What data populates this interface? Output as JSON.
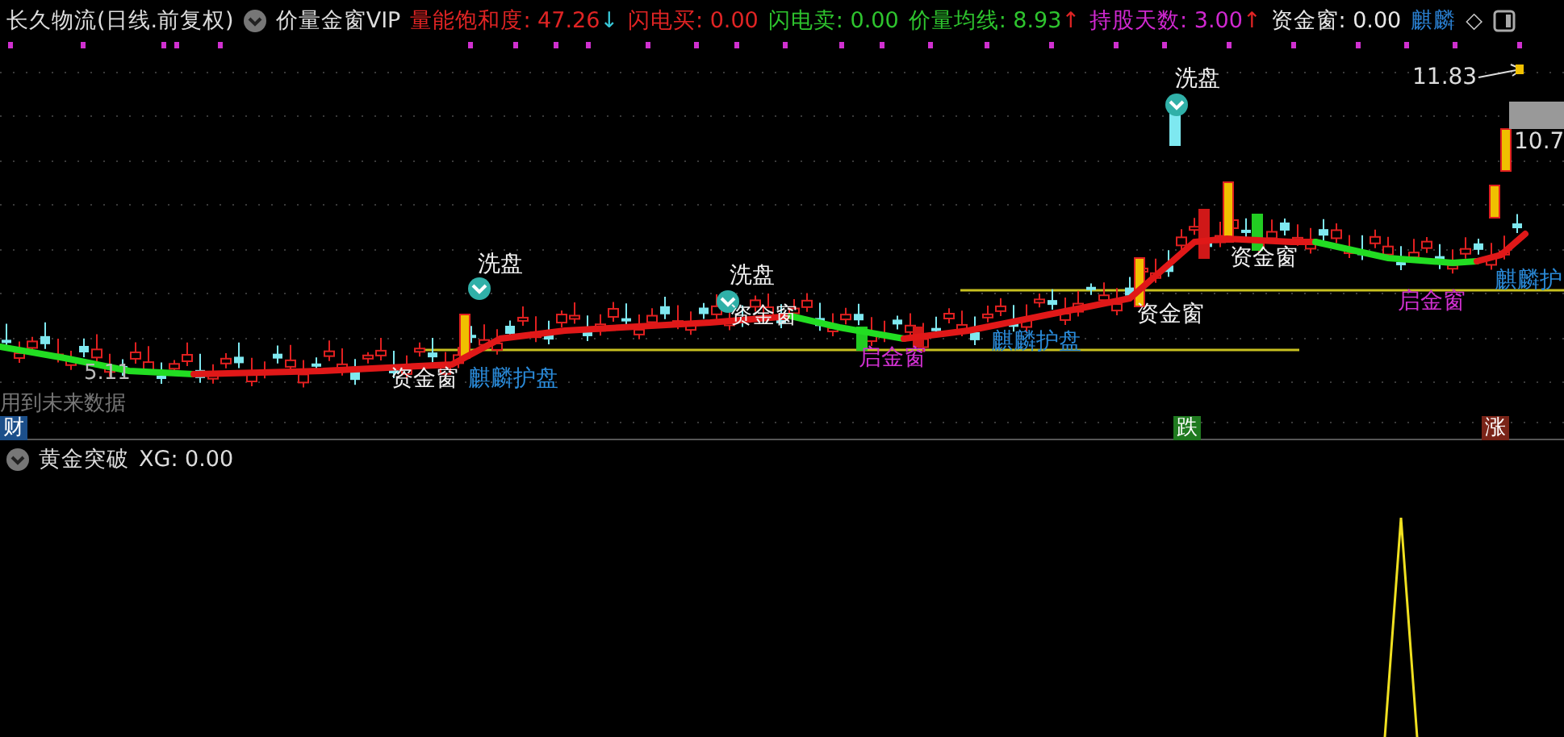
{
  "header": {
    "stock": "长久物流(日线.前复权)",
    "indicator": "价量金窗VIP"
  },
  "readouts": [
    {
      "text": "量能饱和度: 47.26",
      "color": "#e02424",
      "arrow": {
        "text": "↓",
        "kind": "down"
      }
    },
    {
      "text": "闪电买: 0.00",
      "color": "#e02424"
    },
    {
      "text": "闪电卖: 0.00",
      "color": "#2ec42e"
    },
    {
      "text": "价量均线: 8.93",
      "color": "#2ec42e",
      "arrow": {
        "text": "↑",
        "kind": "up"
      }
    },
    {
      "text": "持股天数: 3.00",
      "color": "#d028d0",
      "arrow": {
        "text": "↑",
        "kind": "up"
      }
    },
    {
      "text": "资金窗: 0.00",
      "color": "#e8e8e8"
    },
    {
      "text": "麒麟",
      "color": "#2a7fd0"
    }
  ],
  "header_mark": "◇",
  "annotations": [
    {
      "kind": "wash",
      "text": "洗盘"
    },
    {
      "kind": "wash",
      "text": "洗盘"
    },
    {
      "kind": "wash",
      "text": "洗盘"
    },
    {
      "kind": "fund",
      "text": "资金窗"
    },
    {
      "kind": "fund",
      "text": "资金窗"
    },
    {
      "kind": "fund",
      "text": "资金窗"
    },
    {
      "kind": "fund",
      "text": "资金窗"
    },
    {
      "kind": "guard",
      "text": "麒麟护盘"
    },
    {
      "kind": "guard",
      "text": "麒麟护盘"
    },
    {
      "kind": "guard",
      "text": "麒麟护"
    },
    {
      "kind": "start",
      "text": "启金窗"
    },
    {
      "kind": "start",
      "text": "启金窗"
    }
  ],
  "price_high": "11.83",
  "price_last": "10.7",
  "price_low": "5.11",
  "notice": "用到未来数据",
  "badges": [
    {
      "text": "财",
      "color": "#1c4f8a"
    },
    {
      "text": "跌",
      "color": "#1f7a1f"
    },
    {
      "text": "涨",
      "color": "#7a2418"
    }
  ],
  "lower_panel": {
    "title": "黄金突破",
    "reading": "XG: 0.00"
  }
}
